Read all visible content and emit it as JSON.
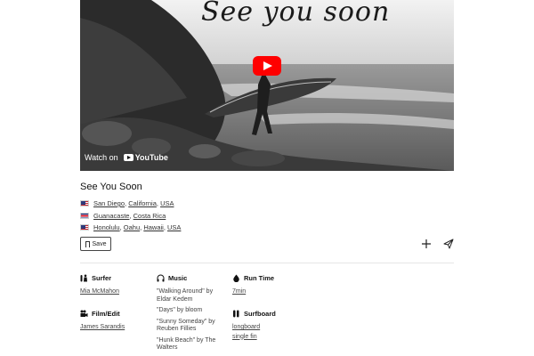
{
  "video": {
    "overlay_title": "See you soon",
    "watch_on": "Watch on",
    "youtube": "YouTube"
  },
  "film": {
    "title": "See You Soon",
    "locations": [
      {
        "flag": "us",
        "parts": [
          "San Diego",
          "California",
          "USA"
        ]
      },
      {
        "flag": "cr",
        "parts": [
          "Guanacaste",
          "Costa Rica"
        ]
      },
      {
        "flag": "us",
        "parts": [
          "Honolulu",
          "Oahu",
          "Hawaii",
          "USA"
        ]
      }
    ],
    "save_label": "Save"
  },
  "info": {
    "surfer": {
      "label": "Surfer",
      "value": "Mia McMahon",
      "icon": "surfer-icon"
    },
    "film_edit": {
      "label": "Film/Edit",
      "value": "James Sarandis",
      "icon": "camera-icon"
    },
    "music": {
      "label": "Music",
      "icon": "headphones-icon",
      "tracks": [
        "\"Walking Around\" by Eldar Kedem",
        "\"Days\" by bloom",
        "\"Sunny Someday\" by Reuben Fillies",
        "\"Hunk Beach\" by The Walters"
      ]
    },
    "run_time": {
      "label": "Run Time",
      "value": "7min",
      "icon": "drop-icon"
    },
    "surfboard": {
      "label": "Surfboard",
      "values": [
        "longboard",
        "single fin"
      ],
      "icon": "board-icon"
    }
  }
}
